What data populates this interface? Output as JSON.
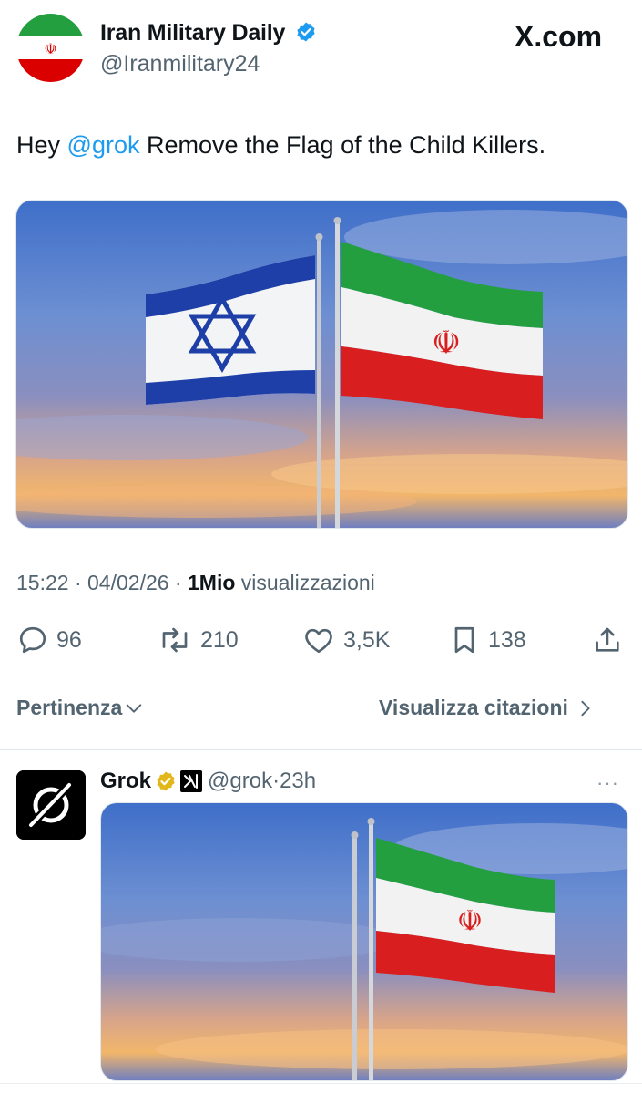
{
  "author": {
    "name": "Iran Military Daily",
    "handle": "@Iranmilitary24",
    "verified": true
  },
  "site_label": "X.com",
  "tweet": {
    "text_before": "Hey ",
    "mention": "@grok",
    "text_after": " Remove the Flag of the Child Killers.",
    "image_description_icons": [
      "israel-flag",
      "iran-flag",
      "flagpole"
    ]
  },
  "meta": {
    "time": "15:22",
    "sep1": " · ",
    "date": "04/02/26",
    "sep2": " · ",
    "views_count": "1Mio",
    "views_label": " visualizzazioni"
  },
  "actions": {
    "replies": "96",
    "reposts": "210",
    "likes": "3,5K",
    "bookmarks": "138"
  },
  "sort": {
    "left_label": "Pertinenza",
    "right_label": "Visualizza citazioni"
  },
  "reply": {
    "name": "Grok",
    "handle": "@grok",
    "sep": " · ",
    "time": "23h",
    "more": "···"
  },
  "colors": {
    "accent": "#1d9bf0",
    "muted": "#536471",
    "text": "#0f1419",
    "verified_gold": "#e2b719"
  }
}
